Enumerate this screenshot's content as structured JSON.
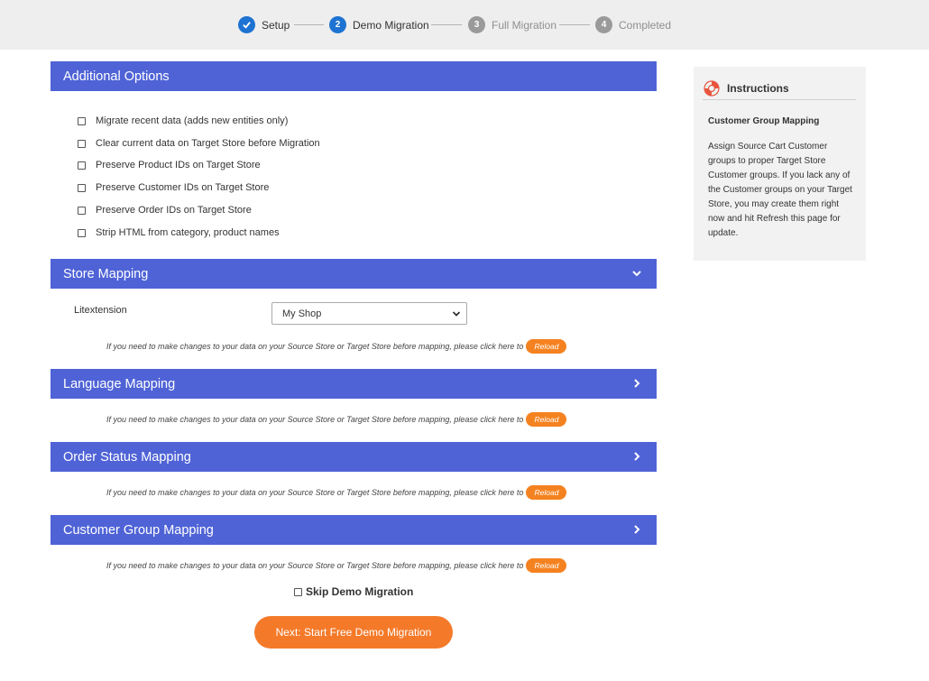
{
  "stepper": {
    "steps": [
      {
        "number": "",
        "label": "Setup",
        "state": "done"
      },
      {
        "number": "2",
        "label": "Demo Migration",
        "state": "active"
      },
      {
        "number": "3",
        "label": "Full Migration",
        "state": "todo"
      },
      {
        "number": "4",
        "label": "Completed",
        "state": "todo"
      }
    ]
  },
  "additional_options": {
    "title": "Additional Options",
    "options": [
      {
        "label": "Migrate recent data (adds new entities only)",
        "checked": false
      },
      {
        "label": "Clear current data on Target Store before Migration",
        "checked": false
      },
      {
        "label": "Preserve Product IDs on Target Store",
        "checked": false
      },
      {
        "label": "Preserve Customer IDs on Target Store",
        "checked": false
      },
      {
        "label": "Preserve Order IDs on Target Store",
        "checked": false
      },
      {
        "label": "Strip HTML from category, product names",
        "checked": false
      }
    ]
  },
  "store_mapping": {
    "title": "Store Mapping",
    "source_label": "Litextension",
    "selected_store": "My Shop"
  },
  "language_mapping": {
    "title": "Language Mapping"
  },
  "order_status_mapping": {
    "title": "Order Status Mapping"
  },
  "customer_group_mapping": {
    "title": "Customer Group Mapping"
  },
  "reload_note": {
    "text": "If you need to make changes to your data on your Source Store or Target Store before mapping, please click here to",
    "button": "Reload"
  },
  "skip_demo": {
    "label": "Skip Demo Migration",
    "checked": false
  },
  "next_button": "Next: Start Free Demo Migration",
  "instructions": {
    "title": "Instructions",
    "subtitle": "Customer Group Mapping",
    "body": "Assign Source Cart Customer groups to proper Target Store Customer groups. If you lack any of the Customer groups on your Target Store, you may create them right now and hit Refresh this page for update."
  },
  "colors": {
    "header_bar": "#4f63d6",
    "accent_orange": "#f47a2a",
    "step_active": "#1e73d2",
    "step_inactive": "#9a9a9a"
  }
}
